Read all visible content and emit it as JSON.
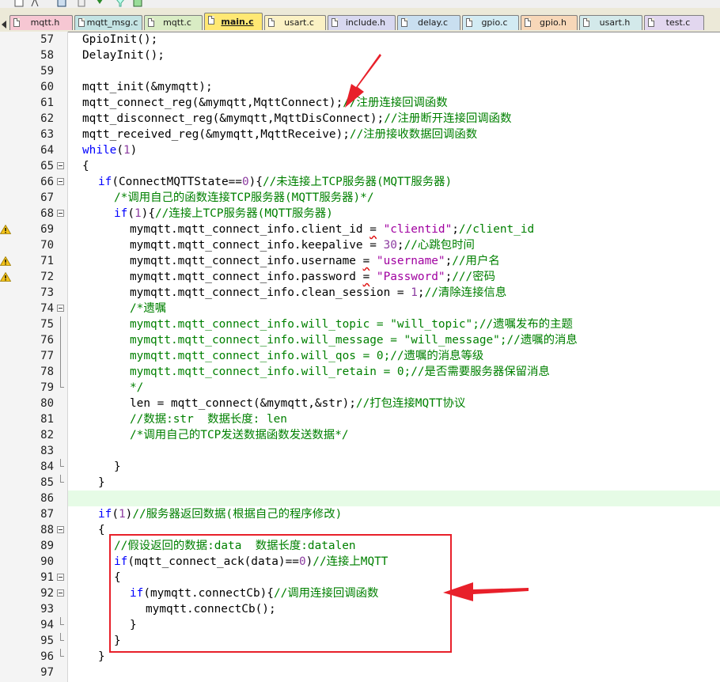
{
  "tabs": [
    {
      "label": "mqtt.h",
      "color": "#f6c7d3",
      "active": false
    },
    {
      "label": "mqtt_msg.c",
      "color": "#c3e3e3",
      "active": false
    },
    {
      "label": "mqtt.c",
      "color": "#d9ecc4",
      "active": false
    },
    {
      "label": "main.c",
      "color": "#ffe873",
      "active": true
    },
    {
      "label": "usart.c",
      "color": "#fbf1c4",
      "active": false
    },
    {
      "label": "include.h",
      "color": "#d8d8f0",
      "active": false
    },
    {
      "label": "delay.c",
      "color": "#c9dff0",
      "active": false
    },
    {
      "label": "gpio.c",
      "color": "#d2ebf3",
      "active": false
    },
    {
      "label": "gpio.h",
      "color": "#f7d7b8",
      "active": false
    },
    {
      "label": "usart.h",
      "color": "#d3e9ea",
      "active": false
    },
    {
      "label": "test.c",
      "color": "#e2d7ef",
      "active": false
    }
  ],
  "editor": {
    "lines": [
      {
        "n": "57",
        "fold": "",
        "warn": false,
        "hl": false,
        "indent": 0,
        "parts": [
          [
            "GpioInit();",
            ""
          ]
        ]
      },
      {
        "n": "58",
        "fold": "",
        "warn": false,
        "hl": false,
        "indent": 0,
        "parts": [
          [
            "DelayInit();",
            ""
          ]
        ]
      },
      {
        "n": "59",
        "fold": "",
        "warn": false,
        "hl": false,
        "indent": 0,
        "parts": []
      },
      {
        "n": "60",
        "fold": "",
        "warn": false,
        "hl": false,
        "indent": 0,
        "parts": [
          [
            "mqtt_init(&mymqtt);",
            ""
          ]
        ]
      },
      {
        "n": "61",
        "fold": "",
        "warn": false,
        "hl": false,
        "indent": 0,
        "parts": [
          [
            "mqtt_connect_reg(&mymqtt,MqttConnect);",
            ""
          ],
          [
            "//注册连接回调函数",
            "cm"
          ]
        ]
      },
      {
        "n": "62",
        "fold": "",
        "warn": false,
        "hl": false,
        "indent": 0,
        "parts": [
          [
            "mqtt_disconnect_reg(&mymqtt,MqttDisConnect);",
            ""
          ],
          [
            "//注册断开连接回调函数",
            "cm"
          ]
        ]
      },
      {
        "n": "63",
        "fold": "",
        "warn": false,
        "hl": false,
        "indent": 0,
        "parts": [
          [
            "mqtt_received_reg(&mymqtt,MqttReceive);",
            ""
          ],
          [
            "//注册接收数据回调函数",
            "cm"
          ]
        ]
      },
      {
        "n": "64",
        "fold": "",
        "warn": false,
        "hl": false,
        "indent": 0,
        "parts": [
          [
            "while",
            "kw"
          ],
          [
            "(",
            ""
          ],
          [
            "1",
            "nm"
          ],
          [
            ")",
            ""
          ]
        ]
      },
      {
        "n": "65",
        "fold": "open",
        "warn": false,
        "hl": false,
        "indent": 0,
        "parts": [
          [
            "{",
            ""
          ]
        ]
      },
      {
        "n": "66",
        "fold": "open",
        "warn": false,
        "hl": false,
        "indent": 1,
        "parts": [
          [
            "if",
            "kw"
          ],
          [
            "(ConnectMQTTState==",
            ""
          ],
          [
            "0",
            "nm"
          ],
          [
            "){",
            ""
          ],
          [
            "//未连接上TCP服务器(MQTT服务器)",
            "cm"
          ]
        ]
      },
      {
        "n": "67",
        "fold": "",
        "warn": false,
        "hl": false,
        "indent": 2,
        "parts": [
          [
            "/*调用自己的函数连接TCP服务器(MQTT服务器)*/",
            "cm"
          ]
        ]
      },
      {
        "n": "68",
        "fold": "open",
        "warn": false,
        "hl": false,
        "indent": 2,
        "parts": [
          [
            "if",
            "kw"
          ],
          [
            "(",
            ""
          ],
          [
            "1",
            "nm"
          ],
          [
            "){",
            ""
          ],
          [
            "//连接上TCP服务器(MQTT服务器)",
            "cm"
          ]
        ]
      },
      {
        "n": "69",
        "fold": "",
        "warn": true,
        "hl": false,
        "indent": 3,
        "parts": [
          [
            "mymqtt.mqtt_connect_info.client_id ",
            ""
          ],
          [
            "=",
            "sq"
          ],
          [
            " ",
            ""
          ],
          [
            "\"clientid\"",
            "st"
          ],
          [
            ";",
            ""
          ],
          [
            "//client_id",
            "cm"
          ]
        ]
      },
      {
        "n": "70",
        "fold": "",
        "warn": false,
        "hl": false,
        "indent": 3,
        "parts": [
          [
            "mymqtt.mqtt_connect_info.keepalive = ",
            ""
          ],
          [
            "30",
            "nm"
          ],
          [
            ";",
            ""
          ],
          [
            "//心跳包时间",
            "cm"
          ]
        ]
      },
      {
        "n": "71",
        "fold": "",
        "warn": true,
        "hl": false,
        "indent": 3,
        "parts": [
          [
            "mymqtt.mqtt_connect_info.username ",
            ""
          ],
          [
            "=",
            "sq"
          ],
          [
            " ",
            ""
          ],
          [
            "\"username\"",
            "st"
          ],
          [
            ";",
            ""
          ],
          [
            "//用户名",
            "cm"
          ]
        ]
      },
      {
        "n": "72",
        "fold": "",
        "warn": true,
        "hl": false,
        "indent": 3,
        "parts": [
          [
            "mymqtt.mqtt_connect_info.password ",
            ""
          ],
          [
            "=",
            "sq"
          ],
          [
            " ",
            ""
          ],
          [
            "\"Password\"",
            "st"
          ],
          [
            ";",
            ""
          ],
          [
            "///密码",
            "cm"
          ]
        ]
      },
      {
        "n": "73",
        "fold": "",
        "warn": false,
        "hl": false,
        "indent": 3,
        "parts": [
          [
            "mymqtt.mqtt_connect_info.clean_session = ",
            ""
          ],
          [
            "1",
            "nm"
          ],
          [
            ";",
            ""
          ],
          [
            "//清除连接信息",
            "cm"
          ]
        ]
      },
      {
        "n": "74",
        "fold": "open",
        "warn": false,
        "hl": false,
        "indent": 3,
        "parts": [
          [
            "/*遗嘱",
            "cm"
          ]
        ]
      },
      {
        "n": "75",
        "fold": "line",
        "warn": false,
        "hl": false,
        "indent": 3,
        "parts": [
          [
            "mymqtt.mqtt_connect_info.will_topic = \"will_topic\";//遗嘱发布的主题",
            "cm"
          ]
        ]
      },
      {
        "n": "76",
        "fold": "line",
        "warn": false,
        "hl": false,
        "indent": 3,
        "parts": [
          [
            "mymqtt.mqtt_connect_info.will_message = \"will_message\";//遗嘱的消息",
            "cm"
          ]
        ]
      },
      {
        "n": "77",
        "fold": "line",
        "warn": false,
        "hl": false,
        "indent": 3,
        "parts": [
          [
            "mymqtt.mqtt_connect_info.will_qos = 0;//遗嘱的消息等级",
            "cm"
          ]
        ]
      },
      {
        "n": "78",
        "fold": "line",
        "warn": false,
        "hl": false,
        "indent": 3,
        "parts": [
          [
            "mymqtt.mqtt_connect_info.will_retain = 0;//是否需要服务器保留消息",
            "cm"
          ]
        ]
      },
      {
        "n": "79",
        "fold": "end",
        "warn": false,
        "hl": false,
        "indent": 3,
        "parts": [
          [
            "*/",
            "cm"
          ]
        ]
      },
      {
        "n": "80",
        "fold": "",
        "warn": false,
        "hl": false,
        "indent": 3,
        "parts": [
          [
            "len = mqtt_connect(&mymqtt,&str);",
            ""
          ],
          [
            "//打包连接MQTT协议",
            "cm"
          ]
        ]
      },
      {
        "n": "81",
        "fold": "",
        "warn": false,
        "hl": false,
        "indent": 3,
        "parts": [
          [
            "//数据:str  数据长度: len",
            "cm"
          ]
        ]
      },
      {
        "n": "82",
        "fold": "",
        "warn": false,
        "hl": false,
        "indent": 3,
        "parts": [
          [
            "/*调用自己的TCP发送数据函数发送数据*/",
            "cm"
          ]
        ]
      },
      {
        "n": "83",
        "fold": "",
        "warn": false,
        "hl": false,
        "indent": 0,
        "parts": []
      },
      {
        "n": "84",
        "fold": "end",
        "warn": false,
        "hl": false,
        "indent": 2,
        "parts": [
          [
            "}",
            ""
          ]
        ]
      },
      {
        "n": "85",
        "fold": "end",
        "warn": false,
        "hl": false,
        "indent": 1,
        "parts": [
          [
            "}",
            ""
          ]
        ]
      },
      {
        "n": "86",
        "fold": "",
        "warn": false,
        "hl": true,
        "indent": 0,
        "parts": []
      },
      {
        "n": "87",
        "fold": "",
        "warn": false,
        "hl": false,
        "indent": 1,
        "parts": [
          [
            "if",
            "kw"
          ],
          [
            "(",
            ""
          ],
          [
            "1",
            "nm"
          ],
          [
            ")",
            ""
          ],
          [
            "//服务器返回数据(根据自己的程序修改)",
            "cm"
          ]
        ]
      },
      {
        "n": "88",
        "fold": "open",
        "warn": false,
        "hl": false,
        "indent": 1,
        "parts": [
          [
            "{",
            ""
          ]
        ]
      },
      {
        "n": "89",
        "fold": "",
        "warn": false,
        "hl": false,
        "indent": 2,
        "parts": [
          [
            "//假设返回的数据:data  数据长度:datalen",
            "cm"
          ]
        ]
      },
      {
        "n": "90",
        "fold": "",
        "warn": false,
        "hl": false,
        "indent": 2,
        "parts": [
          [
            "if",
            "kw"
          ],
          [
            "(mqtt_connect_ack(data)==",
            ""
          ],
          [
            "0",
            "nm"
          ],
          [
            ")",
            ""
          ],
          [
            "//连接上MQTT",
            "cm"
          ]
        ]
      },
      {
        "n": "91",
        "fold": "open",
        "warn": false,
        "hl": false,
        "indent": 2,
        "parts": [
          [
            "{",
            ""
          ]
        ]
      },
      {
        "n": "92",
        "fold": "open",
        "warn": false,
        "hl": false,
        "indent": 3,
        "parts": [
          [
            "if",
            "kw"
          ],
          [
            "(mymqtt.connectCb){",
            ""
          ],
          [
            "//调用连接回调函数",
            "cm"
          ]
        ]
      },
      {
        "n": "93",
        "fold": "",
        "warn": false,
        "hl": false,
        "indent": 4,
        "parts": [
          [
            "mymqtt.connectCb();",
            ""
          ]
        ]
      },
      {
        "n": "94",
        "fold": "end",
        "warn": false,
        "hl": false,
        "indent": 3,
        "parts": [
          [
            "}",
            ""
          ]
        ]
      },
      {
        "n": "95",
        "fold": "end",
        "warn": false,
        "hl": false,
        "indent": 2,
        "parts": [
          [
            "}",
            ""
          ]
        ]
      },
      {
        "n": "96",
        "fold": "end",
        "warn": false,
        "hl": false,
        "indent": 1,
        "parts": [
          [
            "}",
            ""
          ]
        ]
      },
      {
        "n": "97",
        "fold": "",
        "warn": false,
        "hl": false,
        "indent": 0,
        "parts": []
      }
    ]
  },
  "annotation": {
    "box_color": "#e8202a",
    "arrow_color": "#e8202a"
  }
}
